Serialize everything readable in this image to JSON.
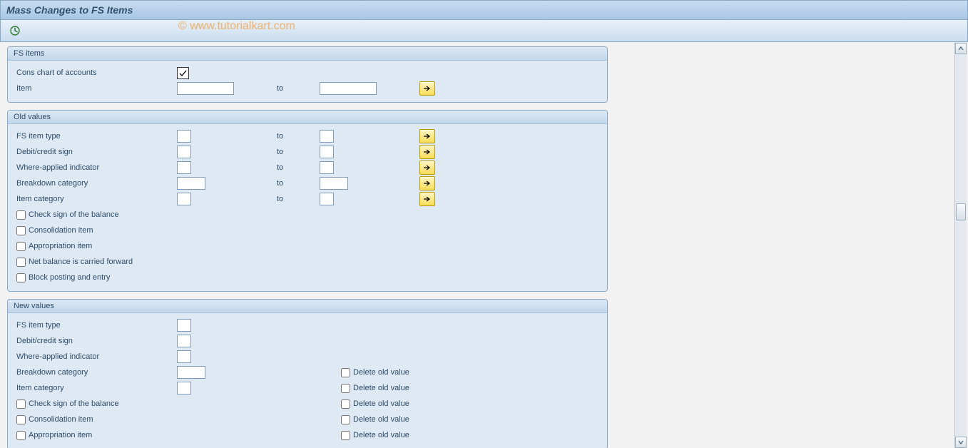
{
  "title": "Mass Changes to FS Items",
  "watermark": "© www.tutorialkart.com",
  "groups": {
    "fs_items": {
      "title": "FS items",
      "cons_chart_label": "Cons chart of accounts",
      "item_label": "Item",
      "to": "to"
    },
    "old_values": {
      "title": "Old values",
      "fs_item_type": "FS item type",
      "debit_credit": "Debit/credit sign",
      "where_applied": "Where-applied indicator",
      "breakdown": "Breakdown category",
      "item_category": "Item category",
      "to": "to",
      "chk_sign": "Check sign of the balance",
      "chk_consolidation": "Consolidation item",
      "chk_appropriation": "Appropriation item",
      "chk_net_balance": "Net balance is carried forward",
      "chk_block": "Block posting and entry"
    },
    "new_values": {
      "title": "New values",
      "fs_item_type": "FS item type",
      "debit_credit": "Debit/credit sign",
      "where_applied": "Where-applied indicator",
      "breakdown": "Breakdown category",
      "item_category": "Item category",
      "delete_old": "Delete old value",
      "chk_sign": "Check sign of the balance",
      "chk_consolidation": "Consolidation item",
      "chk_appropriation": "Appropriation item"
    }
  }
}
